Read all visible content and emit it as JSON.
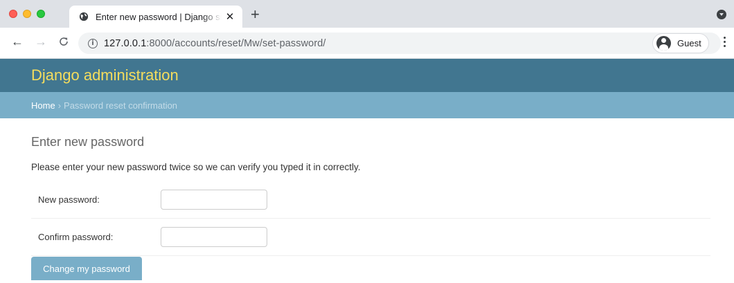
{
  "browser": {
    "tab_title": "Enter new password | Django site admin",
    "close_glyph": "✕",
    "new_tab_glyph": "+",
    "url_host": "127.0.0.1",
    "url_rest": ":8000/accounts/reset/Mw/set-password/",
    "profile_label": "Guest",
    "icons": [
      "globe-icon",
      "close-icon",
      "plus-icon",
      "back-icon",
      "forward-icon",
      "reload-icon",
      "info-icon",
      "avatar-icon",
      "more-icon",
      "tab-search-icon"
    ]
  },
  "admin": {
    "branding": "Django administration",
    "breadcrumbs": {
      "home": "Home",
      "separator": "›",
      "current": "Password reset confirmation"
    },
    "page_title": "Enter new password",
    "intro": "Please enter your new password twice so we can verify you typed it in correctly.",
    "fields": [
      {
        "label": "New password:",
        "value": "",
        "placeholder": ""
      },
      {
        "label": "Confirm password:",
        "value": "",
        "placeholder": ""
      }
    ],
    "submit_label": "Change my password"
  },
  "colors": {
    "header_bg": "#417690",
    "branding": "#f5dd5d",
    "breadcrumbs_bg": "#79aec8",
    "button_bg": "#79aec8"
  }
}
